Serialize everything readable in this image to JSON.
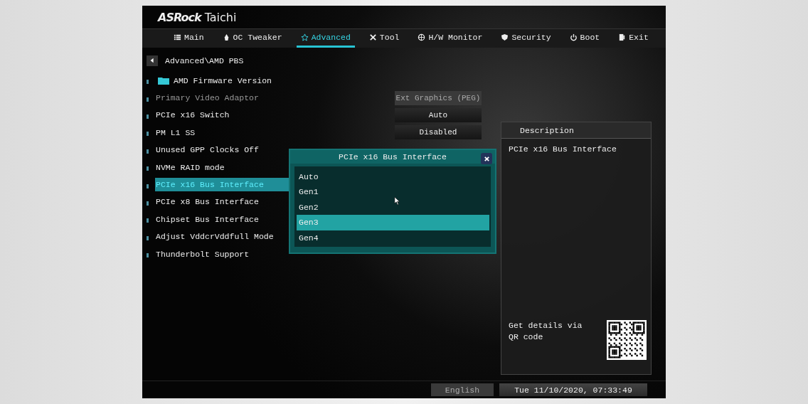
{
  "brand": {
    "name": "ASRock",
    "model": "Taichi"
  },
  "tabs": [
    {
      "label": "Main",
      "selected": false
    },
    {
      "label": "OC Tweaker",
      "selected": false
    },
    {
      "label": "Advanced",
      "selected": true
    },
    {
      "label": "Tool",
      "selected": false
    },
    {
      "label": "H/W Monitor",
      "selected": false
    },
    {
      "label": "Security",
      "selected": false
    },
    {
      "label": "Boot",
      "selected": false
    },
    {
      "label": "Exit",
      "selected": false
    }
  ],
  "breadcrumb": "Advanced\\AMD PBS",
  "items": [
    {
      "label": "AMD Firmware Version",
      "kind": "folder",
      "selected": false,
      "disabled": false
    },
    {
      "label": "Primary Video Adaptor",
      "kind": "setting",
      "selected": false,
      "disabled": true,
      "value": "Ext Graphics (PEG)"
    },
    {
      "label": "PCIe x16 Switch",
      "kind": "setting",
      "selected": false,
      "disabled": false,
      "value": "Auto"
    },
    {
      "label": "PM L1 SS",
      "kind": "setting",
      "selected": false,
      "disabled": false,
      "value": "Disabled"
    },
    {
      "label": "Unused GPP Clocks Off",
      "kind": "setting",
      "selected": false,
      "disabled": false
    },
    {
      "label": "NVMe RAID mode",
      "kind": "setting",
      "selected": false,
      "disabled": false
    },
    {
      "label": "PCIe x16 Bus Interface",
      "kind": "setting",
      "selected": true,
      "disabled": false
    },
    {
      "label": "PCIe x8 Bus Interface",
      "kind": "setting",
      "selected": false,
      "disabled": false
    },
    {
      "label": "Chipset Bus Interface",
      "kind": "setting",
      "selected": false,
      "disabled": false
    },
    {
      "label": "Adjust VddcrVddfull Mode",
      "kind": "setting",
      "selected": false,
      "disabled": false
    },
    {
      "label": "Thunderbolt Support",
      "kind": "setting",
      "selected": false,
      "disabled": false
    }
  ],
  "popup": {
    "title": "PCIe x16 Bus Interface",
    "options": [
      {
        "label": "Auto",
        "selected": false
      },
      {
        "label": "Gen1",
        "selected": false
      },
      {
        "label": "Gen2",
        "selected": false
      },
      {
        "label": "Gen3",
        "selected": true
      },
      {
        "label": "Gen4",
        "selected": false
      }
    ]
  },
  "description": {
    "title": "Description",
    "text": "PCIe x16 Bus Interface",
    "qr_text": "Get details via QR code"
  },
  "status_bar": {
    "language": "English",
    "datetime": "Tue 11/10/2020, 07:33:49"
  }
}
